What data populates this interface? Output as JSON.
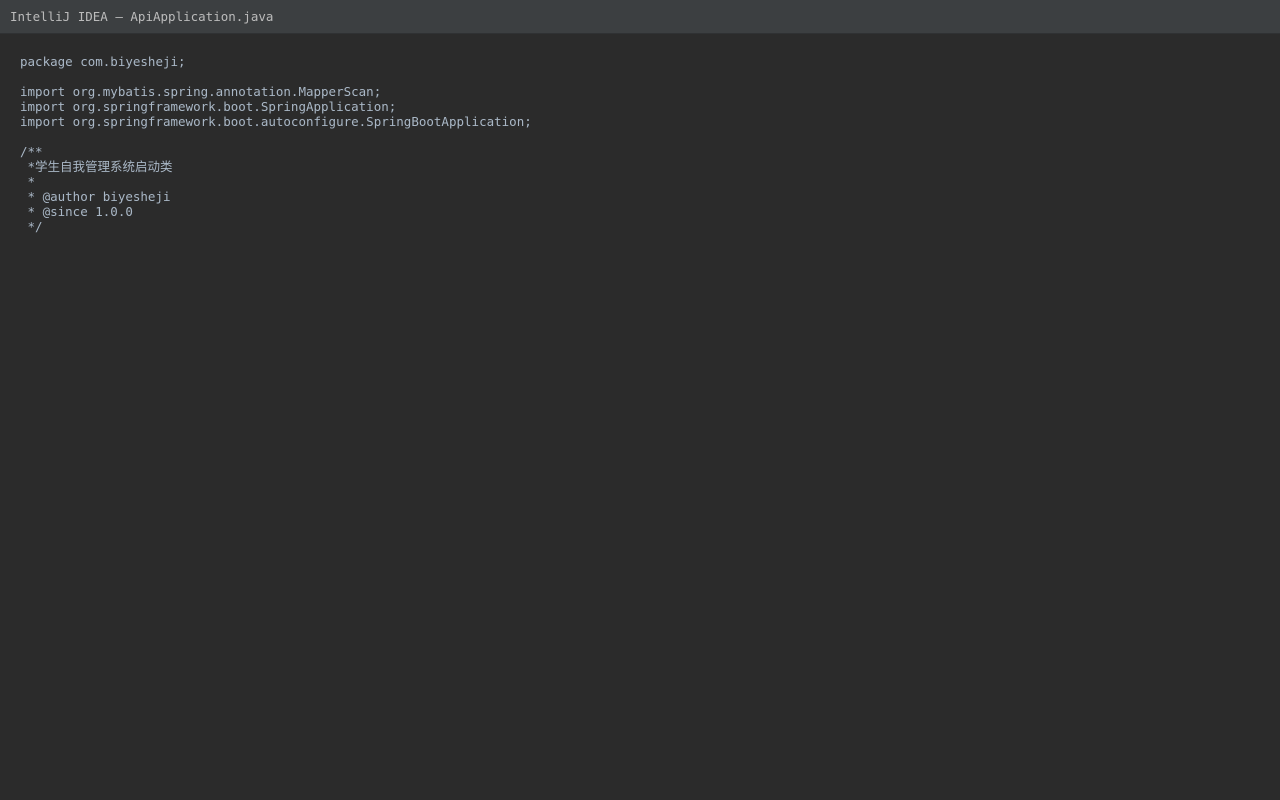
{
  "window": {
    "title": "IntelliJ IDEA — ApiApplication.java"
  },
  "editor": {
    "lines": [
      "package com.biyesheji;",
      "",
      "import org.mybatis.spring.annotation.MapperScan;",
      "import org.springframework.boot.SpringApplication;",
      "import org.springframework.boot.autoconfigure.SpringBootApplication;",
      "",
      "/**",
      " *学生自我管理系统启动类",
      " *",
      " * @author biyesheji",
      " * @since 1.0.0",
      " */"
    ]
  },
  "colors": {
    "editor_background": "#2b2b2b",
    "titlebar_background": "#3c3f41",
    "text": "#a9b7c6",
    "title_text": "#bbbbbb"
  }
}
